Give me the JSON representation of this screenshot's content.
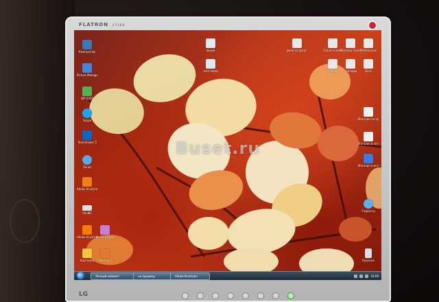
{
  "monitor": {
    "brand": "FLATRON",
    "brand_sub": "1718S",
    "maker": "LG"
  },
  "watermark": "Buset.ru",
  "desktop_icons": [
    {
      "label": "Компьютер",
      "color": "#2f6fb3",
      "icon": "computer-icon"
    },
    {
      "label": "Picture Manager",
      "color": "#3d7fd1",
      "icon": "picture-icon"
    },
    {
      "label": "QIP 2010",
      "color": "#4caf50",
      "icon": "qip-icon"
    },
    {
      "label": "Skype",
      "color": "#1da1f2",
      "icon": "skype-icon"
    },
    {
      "label": "TeamViewer 5",
      "color": "#0e63c6",
      "icon": "teamviewer-icon"
    },
    {
      "label": "iTunes",
      "color": "#5aa9e6",
      "icon": "itunes-icon"
    },
    {
      "label": "Adobe Illustrator",
      "color": "#f07f1b",
      "icon": "illustrator-icon"
    },
    {
      "label": "ЛичФС",
      "color": "#e0e0e0",
      "icon": "drive-icon"
    },
    {
      "label": "Adobe Illustrator",
      "color": "#f57c00",
      "icon": "illustrator-icon"
    },
    {
      "label": "Фотографии",
      "color": "#c77dd6",
      "icon": "photos-icon"
    },
    {
      "label": "Картинки",
      "color": "#f4c542",
      "icon": "star-icon"
    },
    {
      "label": "Мой муз",
      "color": "#e07a2e",
      "icon": "music-icon"
    },
    {
      "label": "акции",
      "color": "#dfe7ef",
      "icon": "document-icon"
    },
    {
      "label": "заготовки",
      "color": "#dfe7ef",
      "icon": "document-icon"
    },
    {
      "label": "дела на август",
      "color": "#e8e8e8",
      "icon": "folder-icon"
    },
    {
      "label": "Future Invest",
      "color": "#e8e8e8",
      "icon": "folder-icon"
    },
    {
      "label": "Юрлица папка",
      "color": "#e8e8e8",
      "icon": "folder-icon"
    },
    {
      "label": "Мебельные",
      "color": "#e8e8e8",
      "icon": "folder-icon"
    },
    {
      "label": "файлы",
      "color": "#e8e8e8",
      "icon": "folder-icon"
    },
    {
      "label": "баннеры",
      "color": "#e8e8e8",
      "icon": "folder-icon"
    },
    {
      "label": "Docs",
      "color": "#e8e8e8",
      "icon": "folder-icon"
    },
    {
      "label": "Магазин по продаже",
      "color": "#f0f0f0",
      "icon": "shop-icon"
    },
    {
      "label": "Магазин в сетевой",
      "color": "#f0f0f0",
      "icon": "shop-icon"
    },
    {
      "label": "Магазин в интернете",
      "color": "#3a7be0",
      "icon": "shop-icon"
    },
    {
      "label": "Гаджеты",
      "color": "#5ab0f0",
      "icon": "gadget-icon"
    },
    {
      "label": "Корзина",
      "color": "#d8dfe6",
      "icon": "trash-icon"
    }
  ],
  "taskbar": {
    "items": [
      "Личный кабинет",
      "на продажу",
      "Adobe Illustrator"
    ],
    "clock": "18:09"
  }
}
